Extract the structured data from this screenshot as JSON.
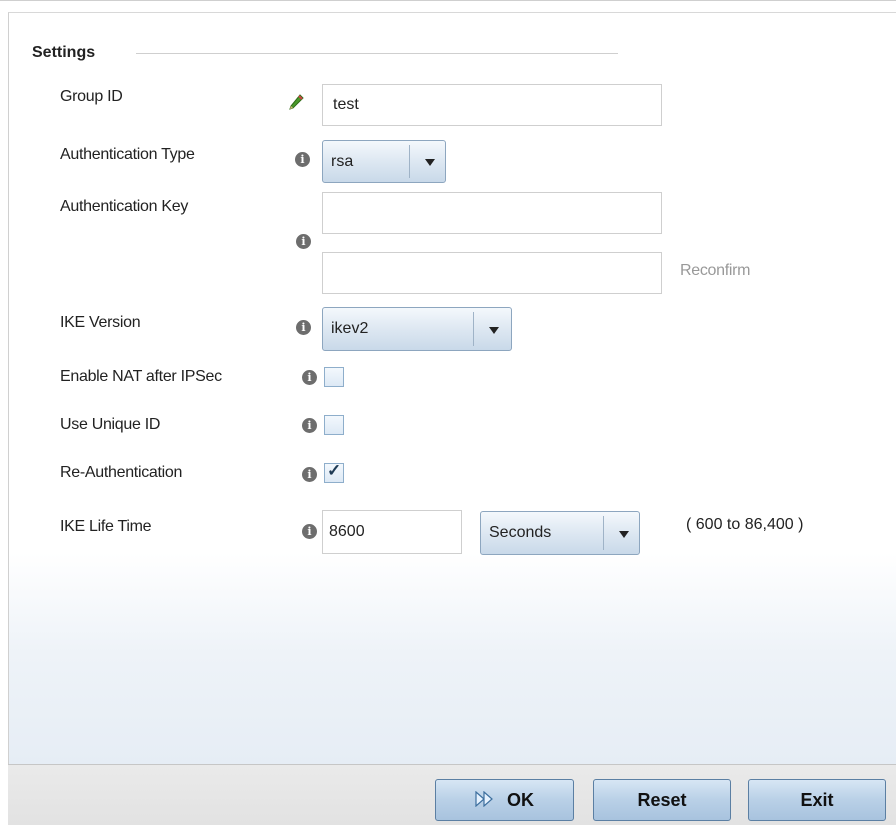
{
  "section": {
    "title": "Settings"
  },
  "fields": {
    "group_id": {
      "label": "Group ID",
      "value": "test"
    },
    "auth_type": {
      "label": "Authentication Type",
      "value": "rsa"
    },
    "auth_key": {
      "label": "Authentication Key",
      "value": "",
      "confirm_value": "",
      "confirm_hint": "Reconfirm"
    },
    "ike_version": {
      "label": "IKE Version",
      "value": "ikev2"
    },
    "enable_nat": {
      "label": "Enable NAT after IPSec",
      "checked": false
    },
    "unique_id": {
      "label": "Use Unique ID",
      "checked": false
    },
    "reauth": {
      "label": "Re-Authentication",
      "checked": true,
      "mark": "✓"
    },
    "ike_lifetime": {
      "label": "IKE Life Time",
      "value": "8600",
      "unit": "Seconds",
      "range": "( 600 to 86,400 )"
    }
  },
  "icons": {
    "info": "i",
    "edit": "pencil-icon"
  },
  "buttons": {
    "ok": "OK",
    "reset": "Reset",
    "exit": "Exit"
  },
  "colors": {
    "button_border": "#5b7fa3",
    "pencil_green": "#4a9a2a",
    "info_gray": "#6d6d6d"
  }
}
